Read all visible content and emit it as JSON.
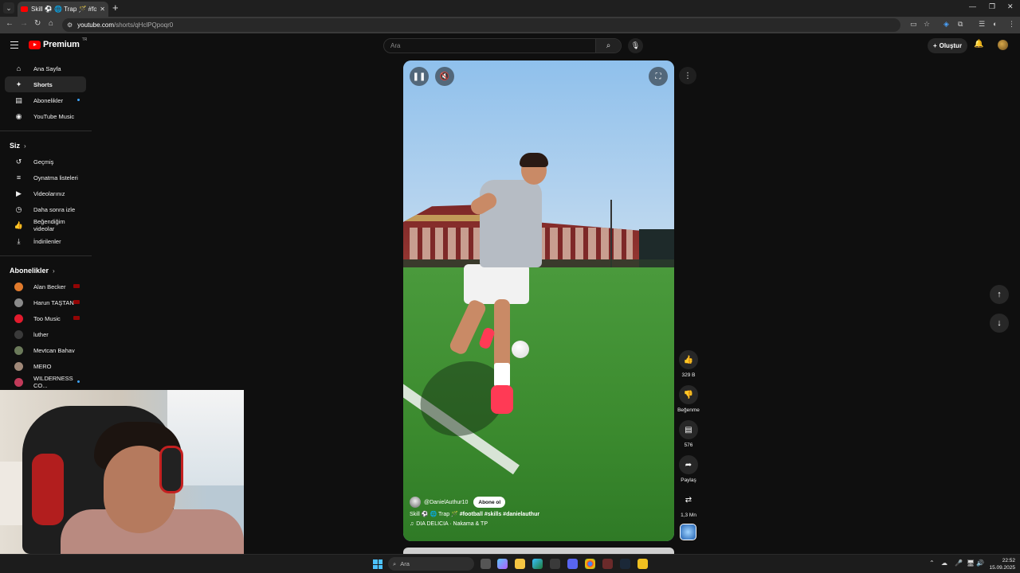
{
  "browser": {
    "tab_title": "Skill ⚽ 🌐 Trap 🪄 #football #",
    "close_glyph": "✕",
    "new_tab_glyph": "+",
    "url_host": "youtube.com",
    "url_path": "/shorts/qHclPQpoqr0",
    "window_controls": [
      "—",
      "❐",
      "✕"
    ]
  },
  "header": {
    "logo_text": "Premium",
    "region": "TR",
    "search_placeholder": "Ara",
    "create_label": "Oluştur"
  },
  "sidebar": {
    "main_items": [
      {
        "label": "Ana Sayfa",
        "icon": "home-icon",
        "glyph": "⌂"
      },
      {
        "label": "Shorts",
        "icon": "shorts-icon",
        "glyph": "✦",
        "active": true
      },
      {
        "label": "Abonelikler",
        "icon": "subscriptions-icon",
        "glyph": "▤",
        "dot": true
      },
      {
        "label": "YouTube Music",
        "icon": "music-icon",
        "glyph": "◉"
      }
    ],
    "you_heading": "Siz",
    "you_items": [
      {
        "label": "Geçmiş",
        "icon": "history-icon",
        "glyph": "↺"
      },
      {
        "label": "Oynatma listeleri",
        "icon": "playlists-icon",
        "glyph": "≡"
      },
      {
        "label": "Videolarınız",
        "icon": "your-videos-icon",
        "glyph": "▶"
      },
      {
        "label": "Daha sonra izle",
        "icon": "watch-later-icon",
        "glyph": "◷"
      },
      {
        "label": "Beğendiğim videolar",
        "icon": "liked-videos-icon",
        "glyph": "👍"
      },
      {
        "label": "İndirilenler",
        "icon": "downloads-icon",
        "glyph": "⤓"
      }
    ],
    "subs_heading": "Abonelikler",
    "subscriptions": [
      {
        "label": "Alan Becker",
        "color": "#e07a2c",
        "live": true
      },
      {
        "label": "Harun TAŞTAN",
        "color": "#8a8a8a",
        "live": true
      },
      {
        "label": "Too Music",
        "color": "#e21b2d",
        "live": true
      },
      {
        "label": "luther",
        "color": "#3a3a3a"
      },
      {
        "label": "Mevtcan Bahav",
        "color": "#6b7a5a"
      },
      {
        "label": "MERO",
        "color": "#a08878"
      },
      {
        "label": "WILDERNESS CO...",
        "color": "#c23b5a",
        "dot": true
      }
    ]
  },
  "short": {
    "channel_handle": "@DanielAuthur10",
    "subscribe_label": "Abone ol",
    "caption_text": "Skill ⚽ 🌐 Trap 🪄 ",
    "caption_tags": "#football #skills #danielauthur",
    "music": "DIA DELICIA · Nakama & TP",
    "music_glyph": "♫"
  },
  "actions": {
    "likes": "329 B",
    "dislike_label": "Beğenme",
    "comments": "576",
    "share_label": "Paylaş",
    "remix_count": "1,3 Mn"
  },
  "taskbar": {
    "search_placeholder": "Ara",
    "time": "22:52",
    "date": "15.09.2025"
  }
}
